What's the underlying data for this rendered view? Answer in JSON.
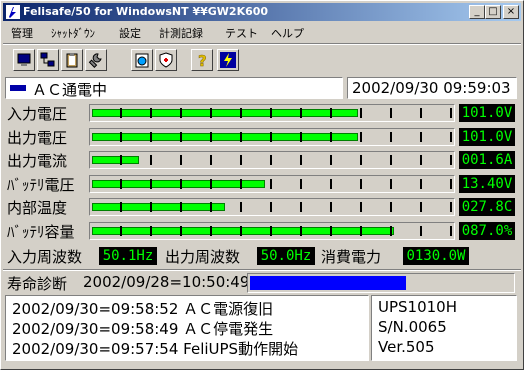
{
  "window": {
    "title": "Felisafe/50 for WindowsNT ¥¥GW2K600",
    "minimize_glyph": "_",
    "maximize_glyph": "□",
    "close_glyph": "×"
  },
  "menu": [
    "管理",
    "ｼｬｯﾄﾀﾞｳﾝ",
    "設定",
    "計測記録",
    "テスト",
    "ヘルプ"
  ],
  "toolbar": [
    "monitor-icon",
    "network-icon",
    "clipboard-icon",
    "wrench-icon",
    "schedule-icon",
    "shield-icon",
    "help-icon",
    "lightning-icon"
  ],
  "status": {
    "mode": "ＡＣ通電中",
    "datetime": "2002/09/30 09:59:03",
    "indicator_color": "#0000a8"
  },
  "meters": [
    {
      "label": "入力電圧",
      "value": "101.0V",
      "level": 0.74
    },
    {
      "label": "出力電圧",
      "value": "101.0V",
      "level": 0.74
    },
    {
      "label": "出力電流",
      "value": "001.6A",
      "level": 0.13
    },
    {
      "label": "ﾊﾞｯﾃﾘ電圧",
      "value": "13.40V",
      "level": 0.48
    },
    {
      "label": "内部温度",
      "value": "027.8C",
      "level": 0.37
    },
    {
      "label": "ﾊﾞｯﾃﾘ容量",
      "value": "087.0%",
      "level": 0.84
    }
  ],
  "readings": {
    "input_freq_label": "入力周波数",
    "input_freq_value": "50.1Hz",
    "output_freq_label": "出力周波数",
    "output_freq_value": "50.0Hz",
    "power_label": "消費電力",
    "power_value": "0130.0W"
  },
  "diagnosis": {
    "label": "寿命診断",
    "datetime": "2002/09/28=10:50:49",
    "progress": 1.0,
    "progress_color": "#0000ff"
  },
  "log": [
    "2002/09/30=09:58:52 ＡＣ電源復旧",
    "2002/09/30=09:58:49 ＡＣ停電発生",
    "2002/09/30=09:57:54 FeliUPS動作開始"
  ],
  "device": {
    "model": "UPS1010H",
    "serial": "S/N.0065",
    "version": "Ver.505"
  },
  "colors": {
    "lcd_bg": "#000000",
    "lcd_text": "#00ff00",
    "bar_fill": "#00ff00"
  }
}
